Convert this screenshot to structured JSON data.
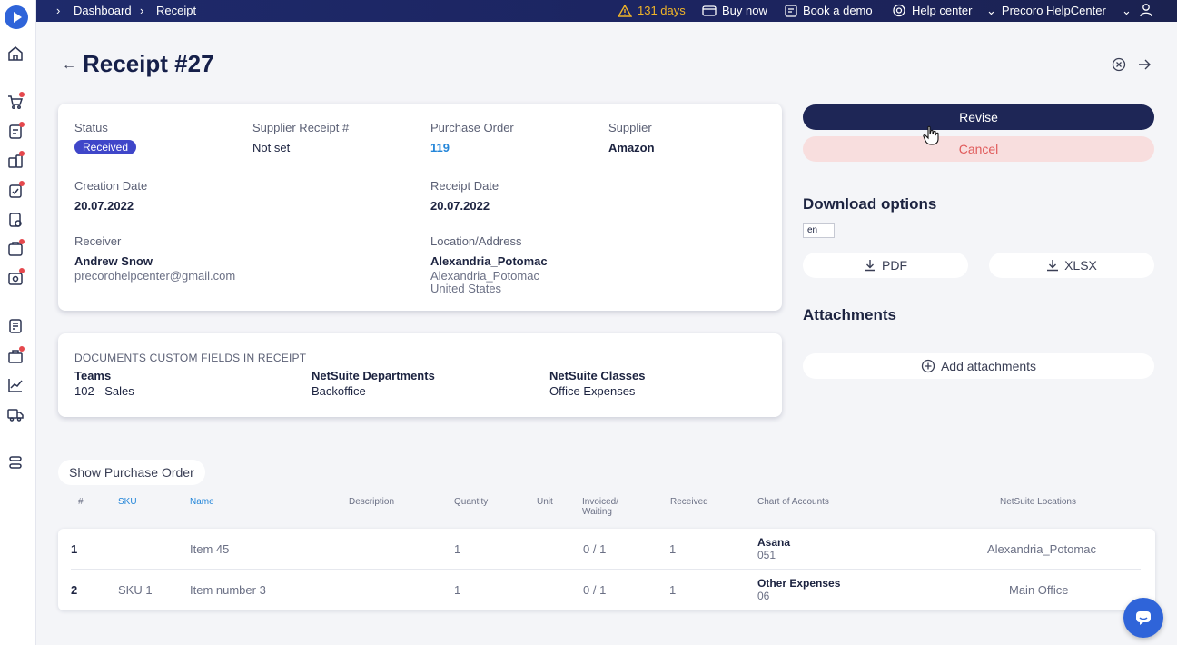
{
  "breadcrumb": {
    "items": [
      "Dashboard",
      "Receipt"
    ]
  },
  "topbar": {
    "trial": "131 days",
    "buy_now": "Buy now",
    "book_demo": "Book a demo",
    "help_center": "Help center",
    "account": "Precoro HelpCenter"
  },
  "page": {
    "title": "Receipt #27"
  },
  "details": {
    "status_label": "Status",
    "status_value": "Received",
    "supplier_receipt_label": "Supplier Receipt #",
    "supplier_receipt_value": "Not set",
    "purchase_order_label": "Purchase Order",
    "purchase_order_value": "119",
    "supplier_label": "Supplier",
    "supplier_value": "Amazon",
    "creation_date_label": "Creation Date",
    "creation_date_value": "20.07.2022",
    "receipt_date_label": "Receipt Date",
    "receipt_date_value": "20.07.2022",
    "receiver_label": "Receiver",
    "receiver_name": "Andrew Snow",
    "receiver_email": "precorohelpcenter@gmail.com",
    "location_label": "Location/Address",
    "location_name": "Alexandria_Potomac",
    "location_line1": "Alexandria_Potomac",
    "location_line2": "United States"
  },
  "custom_fields": {
    "title": "DOCUMENTS CUSTOM FIELDS IN RECEIPT",
    "fields": [
      {
        "label": "Teams",
        "value": "102 - Sales"
      },
      {
        "label": "NetSuite Departments",
        "value": "Backoffice"
      },
      {
        "label": "NetSuite Classes",
        "value": "Office Expenses"
      }
    ]
  },
  "actions": {
    "revise": "Revise",
    "cancel": "Cancel"
  },
  "download": {
    "title": "Download options",
    "language": "en",
    "pdf": "PDF",
    "xlsx": "XLSX"
  },
  "attachments": {
    "title": "Attachments",
    "add": "Add attachments"
  },
  "table": {
    "show_po": "Show Purchase Order",
    "headers": {
      "num": "#",
      "sku": "SKU",
      "name": "Name",
      "description": "Description",
      "quantity": "Quantity",
      "unit": "Unit",
      "invoiced_1": "Invoiced/",
      "invoiced_2": "Waiting",
      "received": "Received",
      "coa": "Chart of Accounts",
      "ns_locations": "NetSuite Locations"
    },
    "rows": [
      {
        "num": "1",
        "sku": "",
        "name": "Item 45",
        "quantity": "1",
        "invoiced": "0 / 1",
        "received": "1",
        "coa_name": "Asana",
        "coa_code": "051",
        "location": "Alexandria_Potomac"
      },
      {
        "num": "2",
        "sku": "SKU 1",
        "name": "Item number 3",
        "quantity": "1",
        "invoiced": "0 / 1",
        "received": "1",
        "coa_name": "Other Expenses",
        "coa_code": "06",
        "location": "Main Office"
      }
    ]
  },
  "colors": {
    "topbar": "#1e2a6b",
    "primary": "#1e2656",
    "badge": "#3f46c9",
    "link": "#2486d9",
    "cancel_bg": "#f8dede",
    "cancel_text": "#e05b5b",
    "warning": "#f0b429"
  }
}
